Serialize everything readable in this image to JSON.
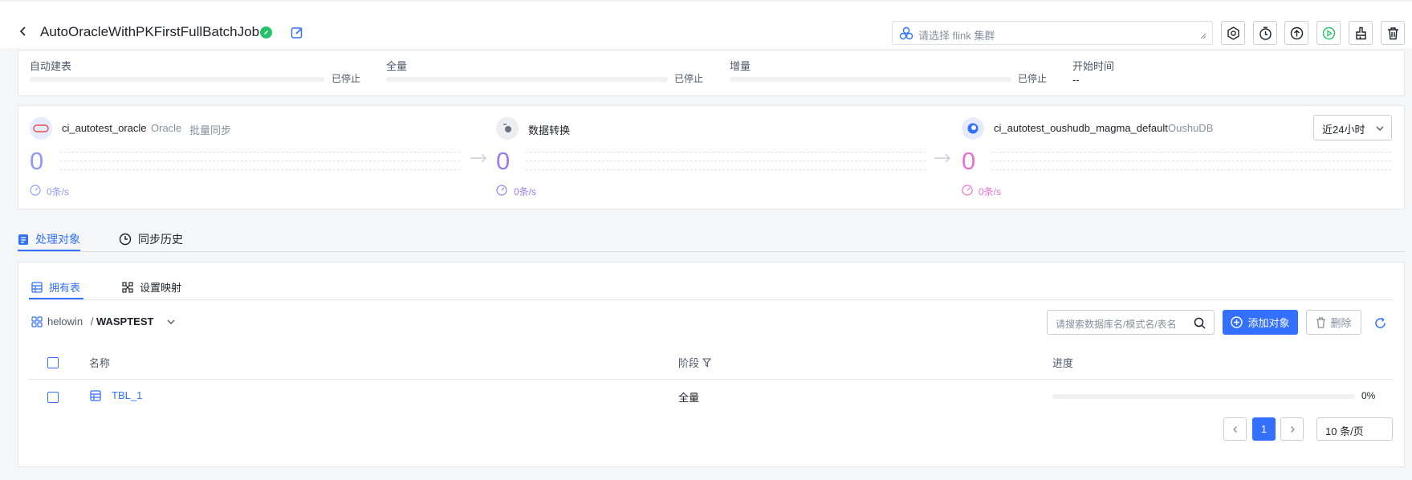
{
  "header": {
    "job_title": "AutoOracleWithPKFirstFullBatchJob",
    "cluster_placeholder": "请选择 flink 集群"
  },
  "progress": {
    "stages": [
      {
        "label": "自动建表",
        "status": "已停止"
      },
      {
        "label": "全量",
        "status": "已停止"
      },
      {
        "label": "增量",
        "status": "已停止"
      }
    ],
    "start_time_label": "开始时间",
    "start_time_value": "--"
  },
  "flow": {
    "source": {
      "name": "ci_autotest_oracle",
      "type": "Oracle",
      "mode": "批量同步",
      "count": "0",
      "rate": "0条/s"
    },
    "transform": {
      "name": "数据转换",
      "count": "0",
      "rate": "0条/s"
    },
    "target": {
      "name": "ci_autotest_oushudb_magma_default",
      "type": "OushuDB",
      "count": "0",
      "rate": "0条/s"
    },
    "time_range": "近24小时"
  },
  "tabs": {
    "objects": "处理对象",
    "history": "同步历史"
  },
  "subtabs": {
    "tables": "拥有表",
    "mapping": "设置映射"
  },
  "schema": {
    "db": "helowin",
    "sep": " / ",
    "name": "WASPTEST"
  },
  "search": {
    "placeholder": "请搜索数据库名/模式名/表名"
  },
  "buttons": {
    "add": "添加对象",
    "delete": "删除"
  },
  "table": {
    "columns": {
      "name": "名称",
      "stage": "阶段",
      "progress": "进度"
    },
    "rows": [
      {
        "name": "TBL_1",
        "stage": "全量",
        "progress_text": "0%",
        "progress": 0
      }
    ]
  },
  "pagination": {
    "current": "1",
    "page_size": "10 条/页"
  },
  "colors": {
    "primary": "#3370ff",
    "success": "#23c26b",
    "flow_purple": "#9b7cf0",
    "flow_pink": "#ee6fd2"
  }
}
